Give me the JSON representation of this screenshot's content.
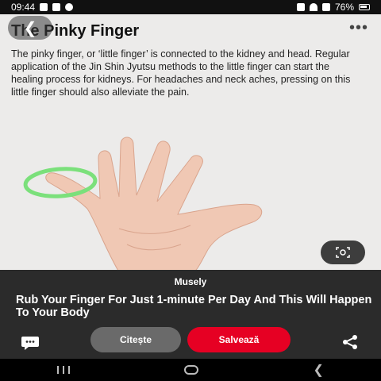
{
  "status_bar": {
    "time": "09:44",
    "battery": "76%"
  },
  "pin": {
    "title": "The Pinky Finger",
    "description": "The pinky finger, or ‘little finger’ is connected to the kidney and head. Regular application of the Jin Shin Jyutsu methods to the little finger can start the healing process for kidneys. For headaches and neck aches, pressing on this little finger should also alleviate the pain.",
    "back_icon": "back-arrow-icon",
    "more_icon": "more-options-icon",
    "lens_icon": "visual-search-icon"
  },
  "bottom": {
    "brand": "Musely",
    "headline": "Rub Your Finger For Just 1-minute Per Day And This Will Happen To Your Body",
    "read_label": "Citește",
    "save_label": "Salvează",
    "comment_icon": "comment-icon",
    "share_icon": "share-icon"
  },
  "colors": {
    "save_red": "#e60023",
    "highlight_green": "#7be07b",
    "bottom_bg": "#2b2b2b"
  }
}
